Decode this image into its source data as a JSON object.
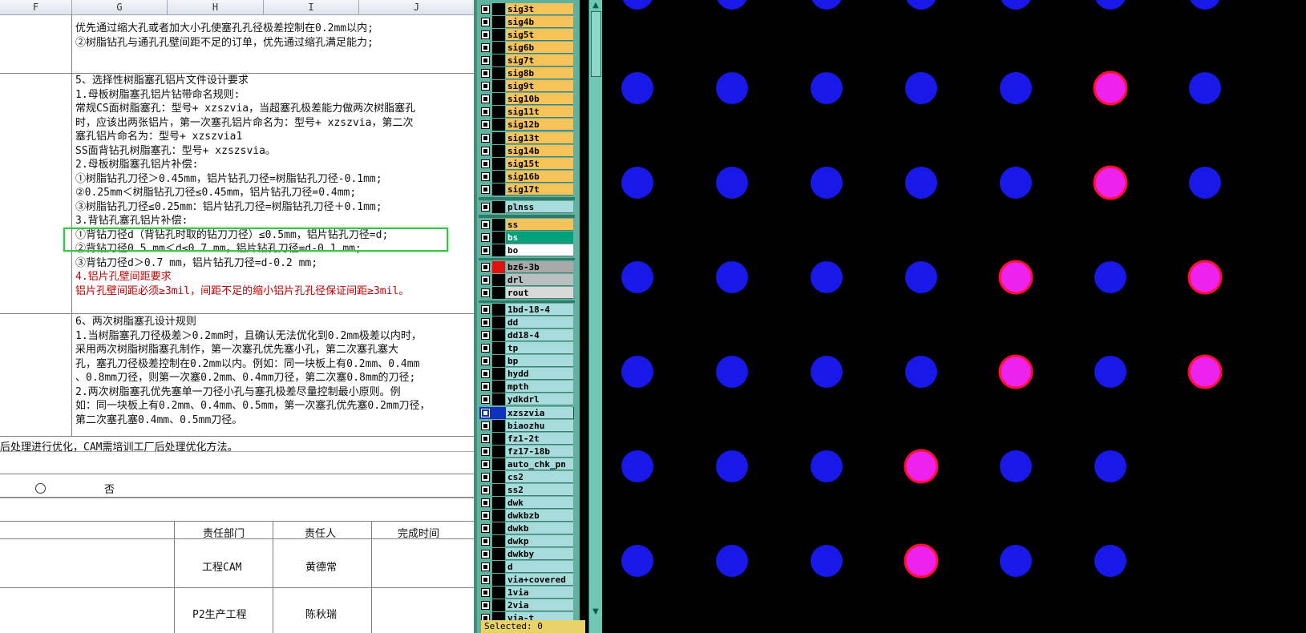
{
  "sheet": {
    "columns": [
      "F",
      "G",
      "H",
      "I",
      "J"
    ],
    "block1": [
      "优先通过缩大孔或者加大小孔使塞孔孔径极差控制在0.2mm以内;",
      "②树脂钻孔与通孔孔壁间距不足的订单，优先通过缩孔满足能力;"
    ],
    "block2": [
      "5、选择性树脂塞孔铝片文件设计要求",
      "1.母板树脂塞孔铝片钻带命名规则:",
      "常规CS面树脂塞孔：型号+ xzszvia，当超塞孔极差能力做两次树脂塞孔",
      "时，应该出两张铝片，第一次塞孔铝片命名为：型号+ xzszvia，第二次",
      "塞孔铝片命名为：型号+ xzszvia1",
      "SS面背钻孔树脂塞孔：型号+ xzszsvia。",
      "2.母板树脂塞孔铝片补偿:",
      "①树脂钻孔刀径＞0.45mm，铝片钻孔刀径=树脂钻孔刀径-0.1mm;",
      "②0.25mm＜树脂钻孔刀径≤0.45mm，铝片钻孔刀径=0.4mm;",
      "③树脂钻孔刀径≤0.25mm：铝片钻孔刀径=树脂钻孔刀径＋0.1mm;",
      "3.背钻孔塞孔铝片补偿:",
      "①背钻刀径d（背钻孔时取的钻刀刀径）≤0.5mm，铝片钻孔刀径=d;",
      "②背钻刀径0.5 mm＜d≤0.7 mm，铝片钻孔刀径=d-0.1 mm;",
      "③背钻刀径d＞0.7 mm，铝片钻孔刀径=d-0.2 mm;"
    ],
    "block2_red": [
      "4.铝片孔壁间距要求",
      "铝片孔壁间距必须≥3mil，间距不足的缩小铝片孔孔径保证间距≥3mil。"
    ],
    "block3": [
      "6、两次树脂塞孔设计规则",
      "1.当树脂塞孔刀径极差＞0.2mm时，且确认无法优化到0.2mm极差以内时，",
      "采用两次树脂树脂塞孔制作，第一次塞孔优先塞小孔，第二次塞孔塞大",
      "孔，塞孔刀径极差控制在0.2mm以内。例如：同一块板上有0.2mm、0.4mm",
      "、0.8mm刀径，则第一次塞0.2mm、0.4mm刀径，第二次塞0.8mm的刀径;",
      "2.两次树脂塞孔优先塞单一刀径小孔与塞孔极差尽量控制最小原则。例",
      "如：同一块板上有0.2mm、0.4mm、0.5mm，第一次塞孔优先塞0.2mm刀径，",
      "第二次塞孔塞0.4mm、0.5mm刀径。"
    ],
    "row_after": "后处理进行优化，CAM需培训工厂后处理优化方法。",
    "option_no": "否",
    "table_headers": [
      "责任部门",
      "责任人",
      "完成时间"
    ],
    "table_rows": [
      {
        "dept": "工程CAM",
        "person": "黄德常"
      },
      {
        "dept": "P2生产工程",
        "person": "陈秋瑞"
      }
    ]
  },
  "layers": {
    "signal": [
      "sig3t",
      "sig4b",
      "sig5t",
      "sig6b",
      "sig7t",
      "sig8b",
      "sig9t",
      "sig10b",
      "sig11t",
      "sig12b",
      "sig13t",
      "sig14b",
      "sig15t",
      "sig16b",
      "sig17t"
    ],
    "plnss": "plnss",
    "mask": [
      {
        "name": "ss",
        "color": "#f5c35a"
      },
      {
        "name": "bs",
        "color": "#00a07a"
      },
      {
        "name": "bo",
        "color": "#ffffff"
      }
    ],
    "drill": [
      {
        "name": "bz6-3b",
        "color": "#a8a8a8",
        "swatch": "#e01010"
      },
      {
        "name": "drl",
        "color": "#b8c0c0",
        "swatch": "#000000"
      },
      {
        "name": "rout",
        "color": "#d8d8d8",
        "swatch": "#000000"
      }
    ],
    "misc": [
      "1bd-18-4",
      "dd",
      "dd18-4",
      "tp",
      "bp",
      "hydd",
      "mpth",
      "ydkdrl",
      "xzszvia",
      "biaozhu",
      "fz1-2t",
      "fz17-18b",
      "auto_chk_pn",
      "cs2",
      "ss2",
      "dwk",
      "dwkbzb",
      "dwkb",
      "dwkp",
      "dwkby",
      "d",
      "via+covered",
      "1via",
      "2via",
      "via-t"
    ],
    "selected": "xzszvia",
    "status_text": "Selected: 0"
  },
  "canvas": {
    "hole_colors": {
      "normal": "#1818e8",
      "flagged": "#ee22ee",
      "flag_ring": "#ff1030"
    },
    "grid_flags": [
      [
        0,
        0,
        0,
        0,
        0,
        0,
        0
      ],
      [
        0,
        0,
        0,
        0,
        0,
        1,
        0
      ],
      [
        0,
        0,
        0,
        0,
        0,
        1,
        0
      ],
      [
        0,
        0,
        0,
        0,
        1,
        0,
        1
      ],
      [
        0,
        0,
        0,
        0,
        1,
        0,
        1
      ],
      [
        0,
        0,
        0,
        1,
        0,
        0,
        -1
      ],
      [
        0,
        0,
        0,
        1,
        0,
        0,
        -1
      ]
    ]
  }
}
